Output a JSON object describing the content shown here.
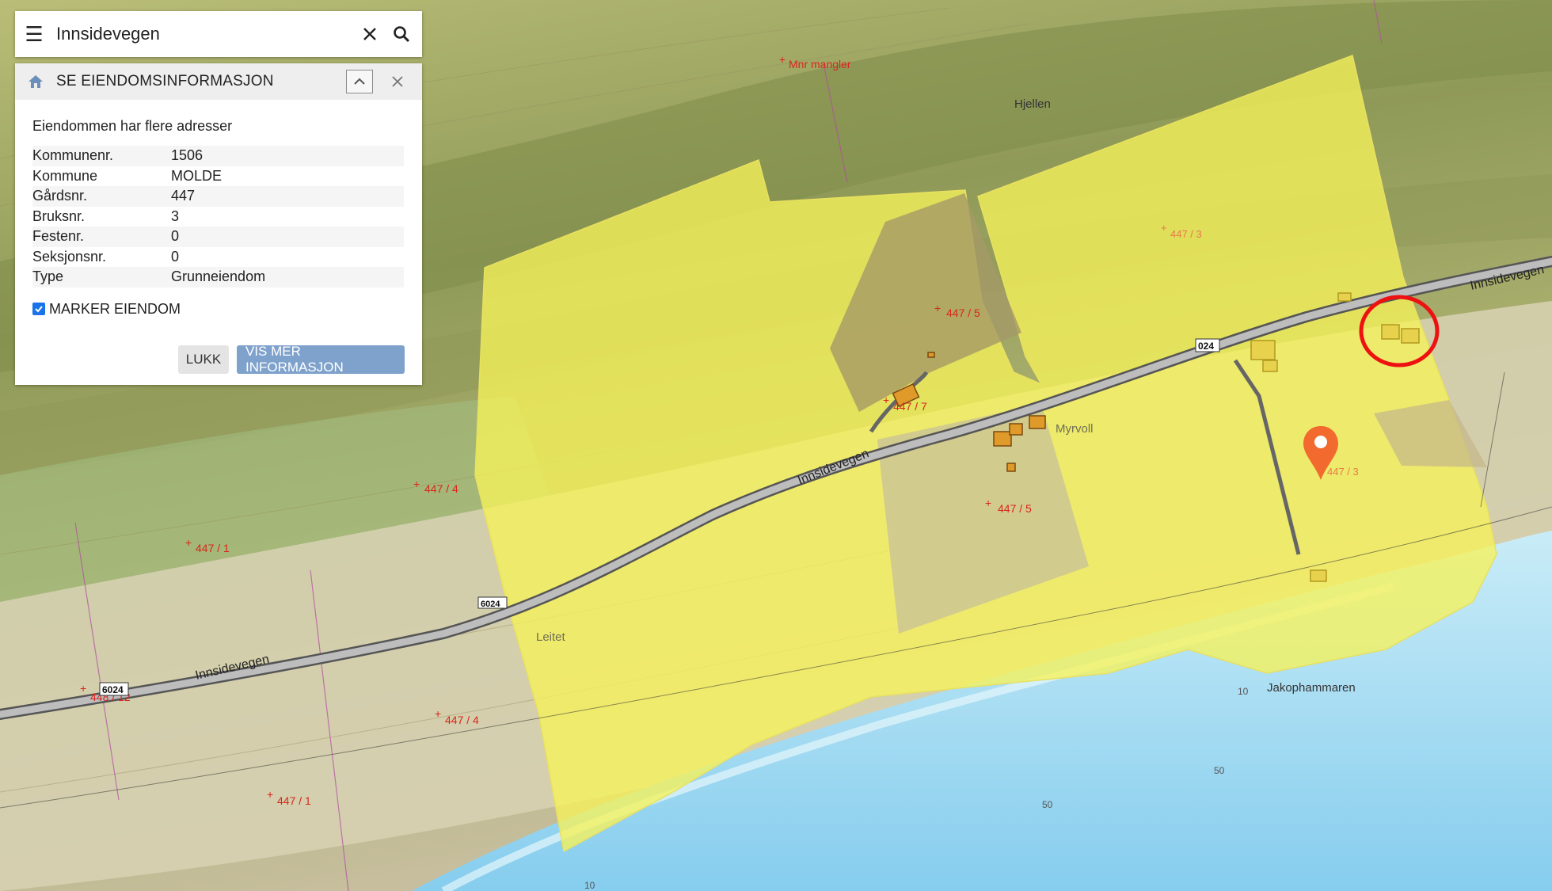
{
  "search": {
    "query": "Innsidevegen"
  },
  "panel": {
    "title": "SE EIENDOMSINFORMASJON",
    "note": "Eiendommen har flere adresser",
    "rows": [
      {
        "label": "Kommunenr.",
        "value": "1506"
      },
      {
        "label": "Kommune",
        "value": "MOLDE"
      },
      {
        "label": "Gårdsnr.",
        "value": "447"
      },
      {
        "label": "Bruksnr.",
        "value": "3"
      },
      {
        "label": "Festenr.",
        "value": "0"
      },
      {
        "label": "Seksjonsnr.",
        "value": "0"
      },
      {
        "label": "Type",
        "value": "Grunneiendom"
      }
    ],
    "marker_label": "MARKER EIENDOM",
    "marker_checked": true,
    "close_label": "LUKK",
    "more_label": "VIS MER INFORMASJON"
  },
  "map": {
    "place_names": {
      "hjellen": "Hjellen",
      "myrvoll": "Myrvoll",
      "leitet": "Leitet",
      "jakophammaren": "Jakophammaren"
    },
    "road_name": "Innsidevegen",
    "road_number_a": "024",
    "road_number_b": "6024",
    "road_number_c": "6024",
    "mnr_missing": "Mnr mangler",
    "parcels": {
      "p447_3_top": "447 / 3",
      "p447_3_pin": "447 / 3",
      "p447_5_a": "447 / 5",
      "p447_5_b": "447 / 5",
      "p447_7": "447 / 7",
      "p447_4_a": "447 / 4",
      "p447_4_b": "447 / 4",
      "p447_1_a": "447 / 1",
      "p447_1_b": "447 / 1",
      "p448_12": "448 / 12"
    },
    "depths": {
      "d10_a": "10",
      "d50_a": "50",
      "d50_b": "50",
      "d10_b": "10"
    },
    "colors": {
      "selected_parcel": "#f6f25a",
      "water": "#b8e4f4",
      "deep_water": "#8fd2f0",
      "hill_dark": "#8d9a56",
      "lowland": "#d7d3b6",
      "highlight_circle": "#e11",
      "marker": "#f26a2d",
      "button_more": "#7fa2cc"
    }
  }
}
